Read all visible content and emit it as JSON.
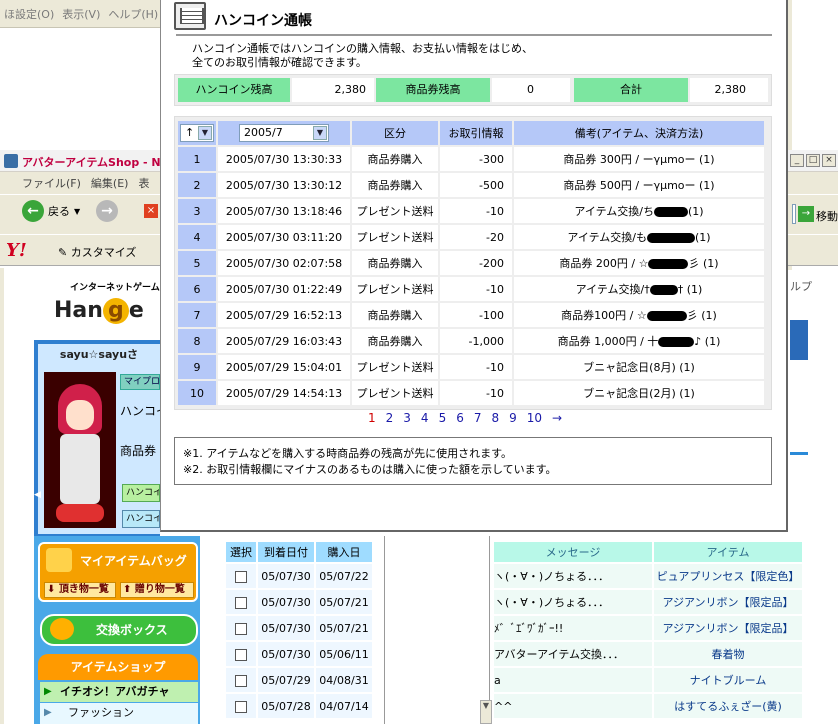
{
  "bg_window": {
    "menu": [
      "ほ設定(O)",
      "表示(V)",
      "ヘルプ(H)"
    ]
  },
  "ie": {
    "title": "アバターアイテムShop - N",
    "menu": [
      "ファイル(F)",
      "編集(E)",
      "表"
    ],
    "back_label": "戻る",
    "go_label": "移動",
    "customize_label": "カスタマイズ",
    "help_label": "ルプ"
  },
  "site": {
    "tagline": "インターネットゲームポー",
    "logo_prefix": "Han",
    "logo_g": "g",
    "logo_suffix": "e",
    "user_name": "sayu☆sayuさ",
    "my_profile_btn": "マイプロ",
    "hancoin_text": "ハンコイン",
    "shohin_text": "商品券",
    "hancoin_btn1": "ハンコイン",
    "hancoin_btn2": "ハンコイン",
    "bag_title": "マイアイテムバッグ",
    "bag_btn1": "頂き物一覧",
    "bag_btn2": "贈り物一覧",
    "exchange_box": "交換ボックス",
    "shop_title": "アイテムショップ",
    "shop_item1": "イチオシ！アバガチャ",
    "shop_item2": "ファッション"
  },
  "gift_list": {
    "headers": [
      "選択",
      "到着日付",
      "購入日"
    ],
    "rows": [
      [
        "05/07/30",
        "05/07/22"
      ],
      [
        "05/07/30",
        "05/07/21"
      ],
      [
        "05/07/30",
        "05/07/21"
      ],
      [
        "05/07/30",
        "05/06/11"
      ],
      [
        "05/07/29",
        "04/08/31"
      ],
      [
        "05/07/28",
        "04/07/14"
      ]
    ],
    "msg_headers": [
      "メッセージ",
      "アイテム"
    ],
    "msg_rows": [
      [
        "ヽ(・∀・)ノちょる．．．",
        "ピュアプリンセス【限定色】"
      ],
      [
        "ヽ(・∀・)ノちょる．．．",
        "アジアンリボン【限定品】"
      ],
      [
        "ﾒ゛ﾞｴﾞﾜﾞｶﾞｰ!!",
        "アジアンリボン【限定品】"
      ],
      [
        "アバターアイテム交換．．．",
        "春着物"
      ],
      [
        "a",
        "ナイトブルーム"
      ],
      [
        "^^",
        "はすてるふぇざー(黄)"
      ]
    ]
  },
  "popup": {
    "title": "ハンコイン通帳",
    "desc_line1": "ハンコイン通帳ではハンコインの購入情報、お支払い情報をはじめ、",
    "desc_line2": "全てのお取引情報が確認できます。",
    "summary": {
      "hancoin_label": "ハンコイン残高",
      "hancoin_value": "2,380",
      "voucher_label": "商品券残高",
      "voucher_value": "0",
      "total_label": "合計",
      "total_value": "2,380"
    },
    "table": {
      "sort_value": "↑",
      "month_value": "2005/7",
      "headers": {
        "category": "区分",
        "amount": "お取引情報",
        "note": "備考(アイテム、決済方法)"
      },
      "rows": [
        {
          "no": "1",
          "datetime": "2005/07/30 13:30:33",
          "category": "商品券購入",
          "amount": "-300",
          "note": "商品券 300円 / ーγμmoー (1)"
        },
        {
          "no": "2",
          "datetime": "2005/07/30 13:30:12",
          "category": "商品券購入",
          "amount": "-500",
          "note": "商品券 500円 / ーγμmoー (1)"
        },
        {
          "no": "3",
          "datetime": "2005/07/30 13:18:46",
          "category": "プレゼント送料",
          "amount": "-10",
          "note_prefix": "アイテム交換/ち",
          "note_suffix": "(1)"
        },
        {
          "no": "4",
          "datetime": "2005/07/30 03:11:20",
          "category": "プレゼント送料",
          "amount": "-20",
          "note_prefix": "アイテム交換/も",
          "note_suffix": "(1)"
        },
        {
          "no": "5",
          "datetime": "2005/07/30 02:07:58",
          "category": "商品券購入",
          "amount": "-200",
          "note_prefix": "商品券 200円 / ☆",
          "note_suffix": "彡 (1)"
        },
        {
          "no": "6",
          "datetime": "2005/07/30 01:22:49",
          "category": "プレゼント送料",
          "amount": "-10",
          "note_prefix": "アイテム交換/†",
          "note_suffix": "† (1)"
        },
        {
          "no": "7",
          "datetime": "2005/07/29 16:52:13",
          "category": "商品券購入",
          "amount": "-100",
          "note_prefix": "商品券100円 / ☆",
          "note_suffix": "彡 (1)"
        },
        {
          "no": "8",
          "datetime": "2005/07/29 16:03:43",
          "category": "商品券購入",
          "amount": "-1,000",
          "note_prefix": "商品券 1,000円 / 十",
          "note_suffix": "♪ (1)"
        },
        {
          "no": "9",
          "datetime": "2005/07/29 15:04:01",
          "category": "プレゼント送料",
          "amount": "-10",
          "note": "ブニャ記念日(8月) (1)"
        },
        {
          "no": "10",
          "datetime": "2005/07/29 14:54:13",
          "category": "プレゼント送料",
          "amount": "-10",
          "note": "ブニャ記念日(2月) (1)"
        }
      ]
    },
    "pager": {
      "pages": [
        "1",
        "2",
        "3",
        "4",
        "5",
        "6",
        "7",
        "8",
        "9",
        "10"
      ],
      "current": "1",
      "next": "→"
    },
    "notes": [
      "※1. アイテムなどを購入する時商品券の残高が先に使用されます。",
      "※2. お取引情報欄にマイナスのあるものは購入に使った額を示しています。"
    ]
  },
  "colors": {
    "header_blue": "#b5c8f8",
    "summary_green": "#7ce6a0",
    "pager_current": "#d00000",
    "pager_link": "#1a1aa8"
  }
}
